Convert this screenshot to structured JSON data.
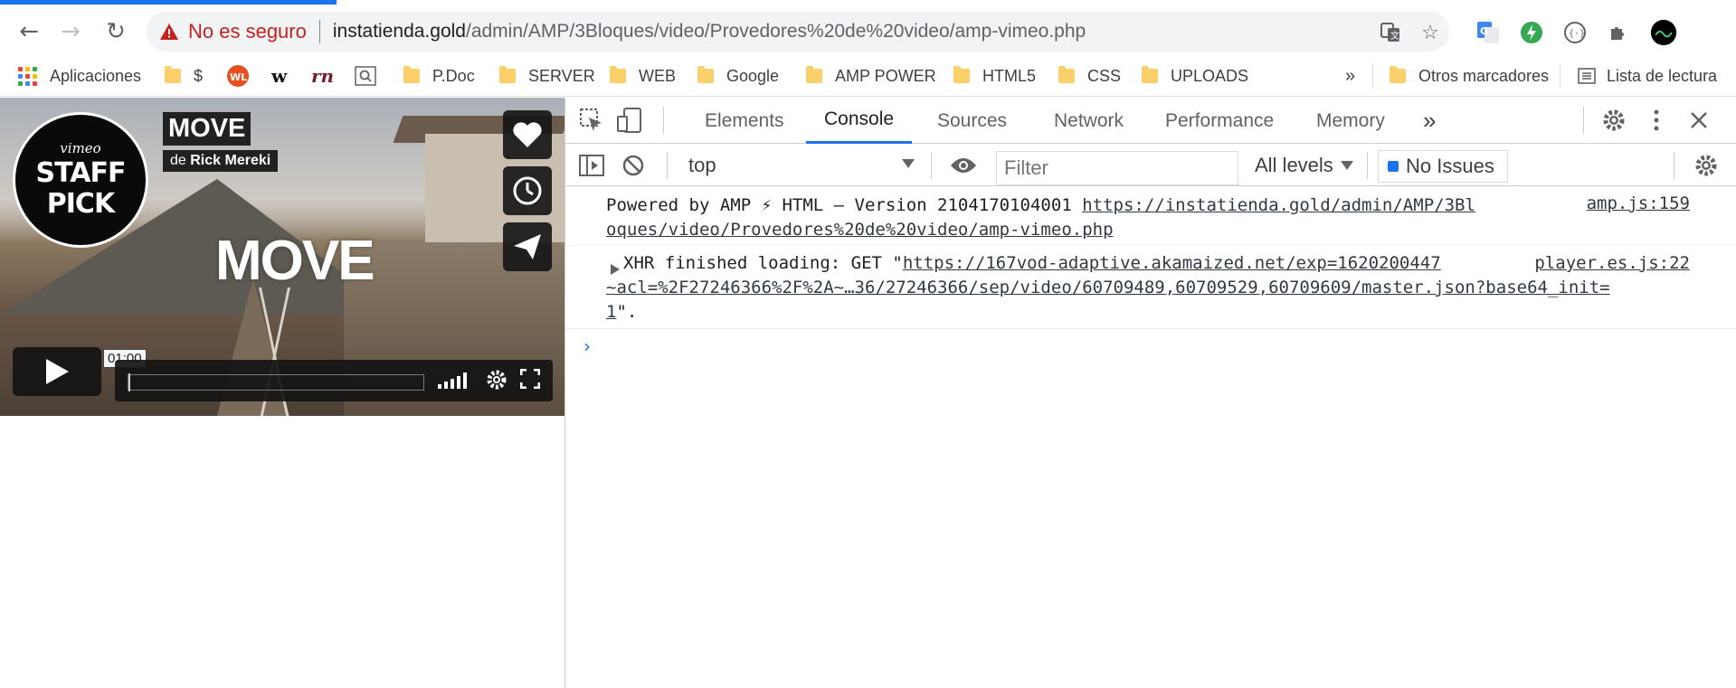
{
  "browser": {
    "back_icon": "←",
    "forward_icon": "→",
    "reload_icon": "↻",
    "security_label": "No es seguro",
    "url_host": "instatienda.gold",
    "url_path": "/admin/AMP/3Bloques/video/Provedores%20de%20video/amp-vimeo.php",
    "star_icon": "☆"
  },
  "bookmarks": {
    "apps": "Aplicaciones",
    "dollar": "$",
    "items": [
      "P.Doc",
      "SERVER",
      "WEB",
      "Google",
      "AMP POWER",
      "HTML5",
      "CSS",
      "UPLOADS"
    ],
    "more": "»",
    "other": "Otros marcadores",
    "reading_list": "Lista de lectura"
  },
  "video": {
    "badge_brand": "vimeo",
    "badge_line1": "STAFF",
    "badge_line2": "PICK",
    "title": "MOVE",
    "by_prefix": "de",
    "author": "Rick Mereki",
    "overlay_text": "MOVE",
    "time_tooltip": "01:00"
  },
  "devtools": {
    "tabs": [
      "Elements",
      "Console",
      "Sources",
      "Network",
      "Performance",
      "Memory"
    ],
    "active_tab": "Console",
    "more_tabs": "»",
    "context": "top",
    "filter_placeholder": "Filter",
    "levels": "All levels",
    "issues": "No Issues",
    "messages": [
      {
        "prefix": "Powered by AMP ⚡ HTML – Version 2104170104001 ",
        "link": "https://instatienda.gold/admin/AMP/3Bl",
        "link2": "oques/video/Provedores%20de%20video/amp-vimeo.php",
        "source": "amp.js:159"
      },
      {
        "prefix": "XHR finished loading: GET \"",
        "link": "https://167vod-adaptive.akamaized.net/exp=1620200447",
        "link2": "~acl=%2F27246366%2F%2A~…36/27246366/sep/video/60709489,60709529,60709609/master.json?base64_init=",
        "link3": "1",
        "suffix": "\".",
        "source": "player.es.js:22"
      }
    ],
    "prompt": "›"
  }
}
